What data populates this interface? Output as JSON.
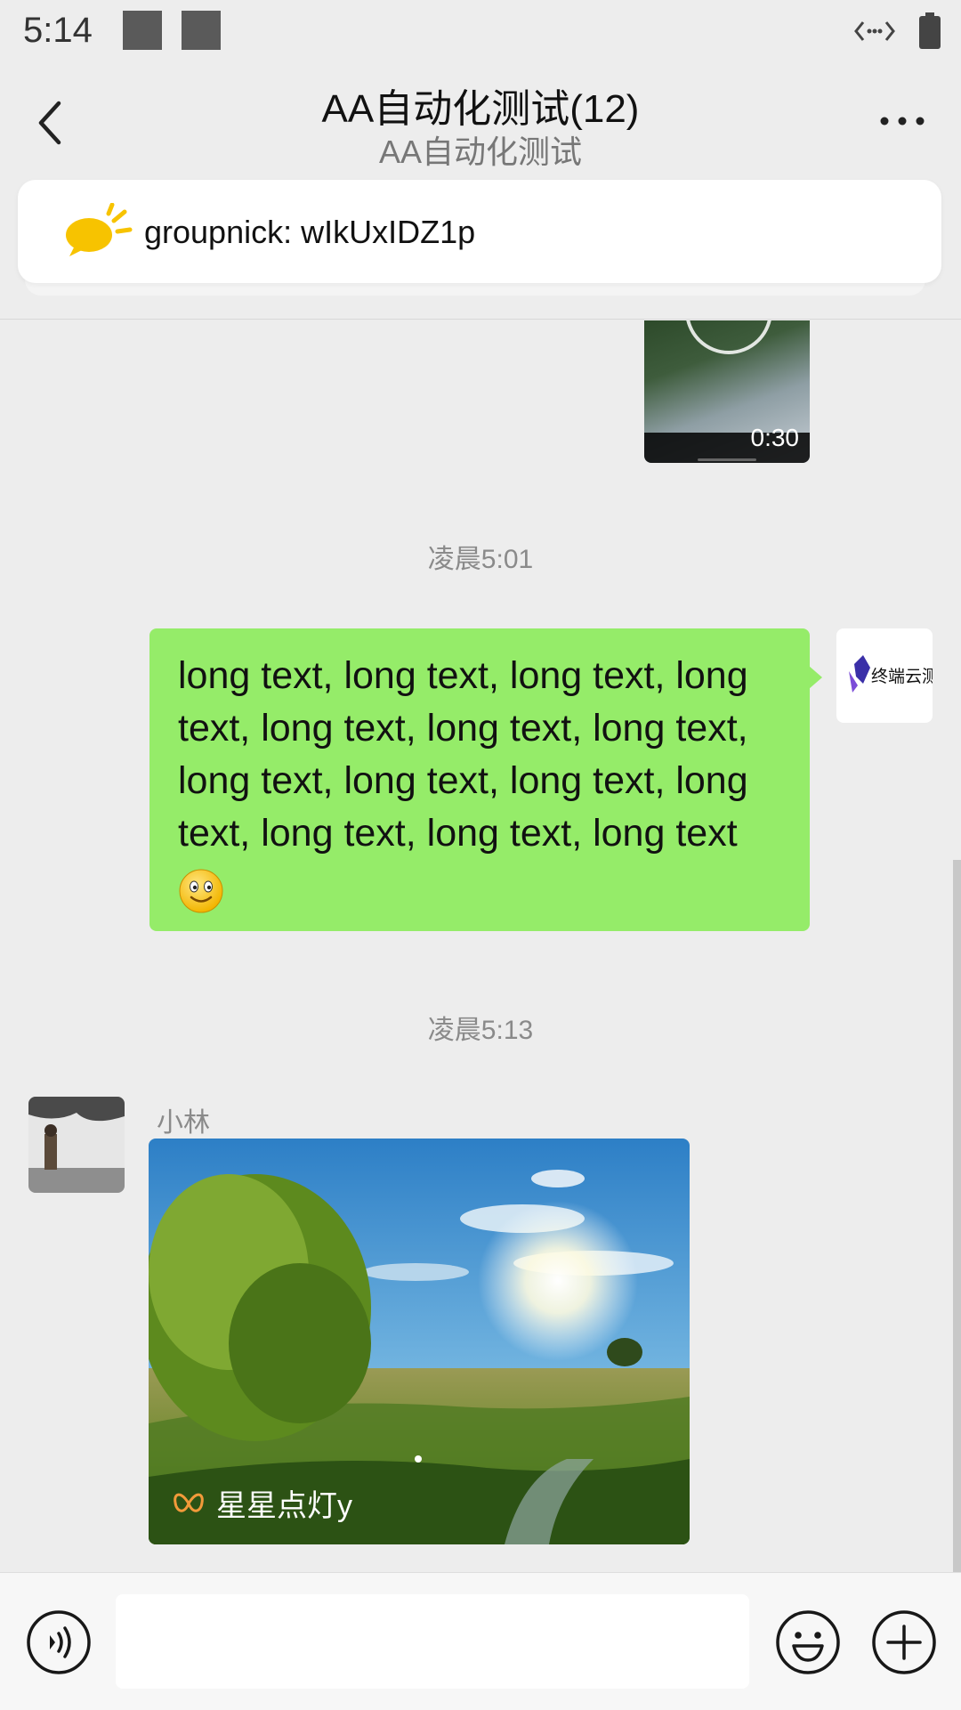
{
  "status_bar": {
    "time": "5:14",
    "icons": [
      "notification-square-icon",
      "notification-square-icon",
      "data-transfer-icon",
      "battery-icon"
    ]
  },
  "header": {
    "title": "AA自动化测试(12)",
    "subtitle": "AA自动化测试",
    "back_icon": "chevron-left-icon",
    "more_icon": "more-icon"
  },
  "notice": {
    "icon": "announcement-icon",
    "text": "groupnick: wIkUxIDZ1p"
  },
  "messages": [
    {
      "type": "video",
      "sender": "self",
      "duration": "0:30"
    },
    {
      "type": "timestamp",
      "text": "凌晨5:01"
    },
    {
      "type": "text",
      "sender": "self",
      "text": "long text, long text, long text, long text, long text, long text, long text, long text, long text, long text, long text, long text, long text, long text",
      "emoji": "smile-emoji-icon",
      "avatar_text": "终端云测"
    },
    {
      "type": "timestamp",
      "text": "凌晨5:13"
    },
    {
      "type": "image",
      "sender": "小林",
      "label": "星星点灯y",
      "label_icon": "butterfly-icon"
    }
  ],
  "input_bar": {
    "voice_icon": "voice-icon",
    "emoji_icon": "emoji-icon",
    "plus_icon": "plus-icon",
    "placeholder": ""
  },
  "colors": {
    "background": "#ededed",
    "bubble_self": "#95ec69",
    "notice_icon": "#f7c300"
  }
}
